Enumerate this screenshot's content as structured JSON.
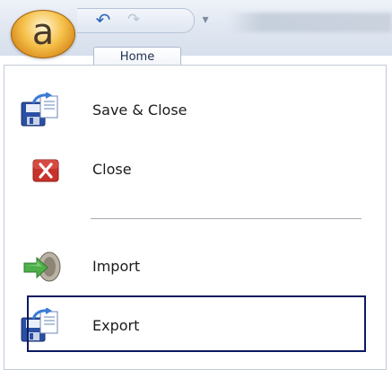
{
  "titlebar": {
    "app_button_letter": "a",
    "qat_undo_icon": "undo-icon",
    "qat_redo_icon": "redo-icon",
    "qat_customize_icon": "customize-dropdown-icon"
  },
  "tabs": [
    {
      "label": "Home"
    }
  ],
  "menu": {
    "items": [
      {
        "label": "Save & Close",
        "icon": "save-close-icon"
      },
      {
        "label": "Close",
        "icon": "close-icon"
      },
      {
        "label": "Import",
        "icon": "import-icon"
      },
      {
        "label": "Export",
        "icon": "export-icon"
      }
    ],
    "selected_item": "Export"
  },
  "colors": {
    "close_red": "#c7322a",
    "save_blue": "#2a4fa3",
    "highlight_border": "#0a1a63",
    "app_button_orange": "#f6c14a"
  }
}
